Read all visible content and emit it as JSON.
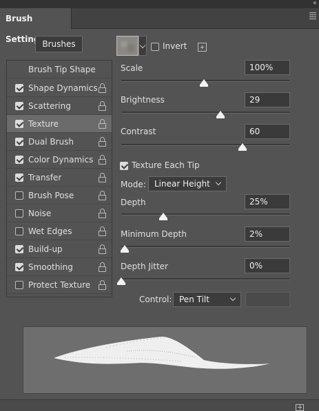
{
  "panel": {
    "tab_title": "Brush Settings",
    "brushes_button": "Brushes"
  },
  "sidebar": {
    "header": "Brush Tip Shape",
    "items": [
      {
        "label": "Shape Dynamics",
        "checked": true,
        "locked": true
      },
      {
        "label": "Scattering",
        "checked": true,
        "locked": true
      },
      {
        "label": "Texture",
        "checked": true,
        "locked": true,
        "selected": true
      },
      {
        "label": "Dual Brush",
        "checked": true,
        "locked": true
      },
      {
        "label": "Color Dynamics",
        "checked": true,
        "locked": true
      },
      {
        "label": "Transfer",
        "checked": true,
        "locked": true
      },
      {
        "label": "Brush Pose",
        "checked": false,
        "locked": true
      },
      {
        "label": "Noise",
        "checked": false,
        "locked": true
      },
      {
        "label": "Wet Edges",
        "checked": false,
        "locked": true
      },
      {
        "label": "Build-up",
        "checked": true,
        "locked": true
      },
      {
        "label": "Smoothing",
        "checked": true,
        "locked": true
      },
      {
        "label": "Protect Texture",
        "checked": false,
        "locked": true
      }
    ]
  },
  "texture": {
    "invert_label": "Invert",
    "invert_checked": false,
    "scale": {
      "label": "Scale",
      "value": "100%"
    },
    "brightness": {
      "label": "Brightness",
      "value": "29"
    },
    "contrast": {
      "label": "Contrast",
      "value": "60"
    },
    "texture_each_tip": {
      "label": "Texture Each Tip",
      "checked": true
    },
    "mode": {
      "label": "Mode:",
      "value": "Linear Height"
    },
    "depth": {
      "label": "Depth",
      "value": "25%"
    },
    "minimum_depth": {
      "label": "Minimum Depth",
      "value": "2%"
    },
    "depth_jitter": {
      "label": "Depth Jitter",
      "value": "0%"
    },
    "control": {
      "label": "Control:",
      "value": "Pen Tilt"
    }
  },
  "colors": {
    "panel_bg": "#535353",
    "selected_row": "#6b6b6b",
    "input_bg": "#3a3a3a",
    "preview_bg": "#6e6e6e"
  }
}
